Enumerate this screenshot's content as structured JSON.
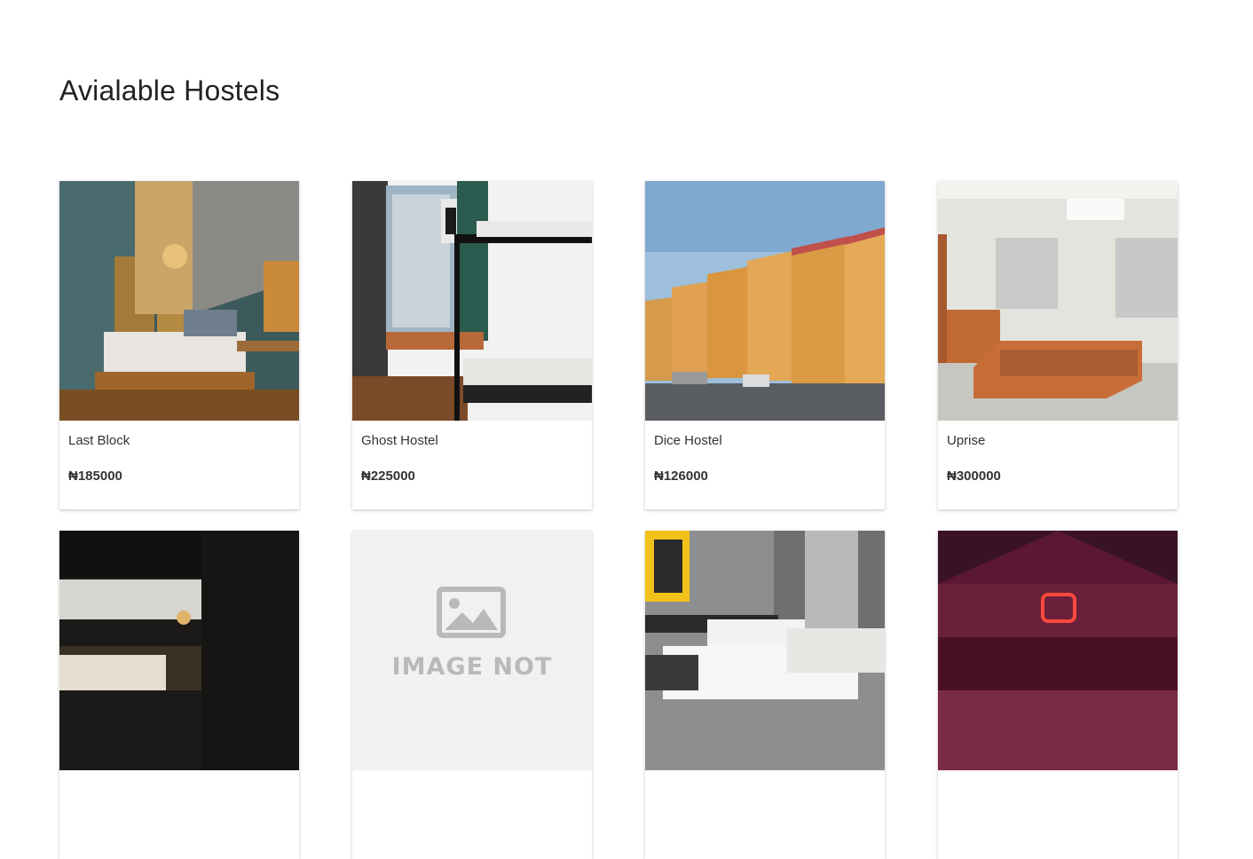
{
  "page": {
    "title": "Avialable Hostels"
  },
  "hostels": [
    {
      "name": "Last Block",
      "price": "₦185000",
      "image": "bedroom-photo"
    },
    {
      "name": "Ghost Hostel",
      "price": "₦225000",
      "image": "bunk-bed-photo"
    },
    {
      "name": "Dice Hostel",
      "price": "₦126000",
      "image": "apartment-building-photo"
    },
    {
      "name": "Uprise",
      "price": "₦300000",
      "image": "empty-room-photo"
    },
    {
      "name": "",
      "price": "",
      "image": "dark-bedroom-photo"
    },
    {
      "name": "",
      "price": "",
      "image": "image-not-available-placeholder",
      "placeholder_text": "IMAGE NOT"
    },
    {
      "name": "",
      "price": "",
      "image": "hotel-room-photo"
    },
    {
      "name": "",
      "price": "",
      "image": "red-lounge-photo"
    }
  ]
}
